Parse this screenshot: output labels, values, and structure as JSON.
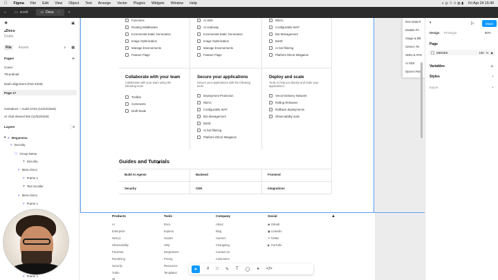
{
  "menubar": {
    "apple": "",
    "app": "Figma",
    "items": [
      "File",
      "Edit",
      "View",
      "Object",
      "Text",
      "Arrange",
      "Vector",
      "Plugins",
      "Widgets",
      "Window",
      "Help"
    ],
    "datetime": "Fri Apr 24 15:49"
  },
  "tabs": [
    {
      "label": "scroll"
    },
    {
      "label": "Docs"
    }
  ],
  "left": {
    "file_title": "Docs",
    "file_sub": "Drafts",
    "tab_file": "File",
    "tab_assets": "Assets",
    "pages_label": "Pages",
    "pages": [
      "Cover",
      "Thumbnail",
      "Dash alignment (Feb 2026)",
      "Page 17",
      "Geistdocs – Audit Chris (12/22/2025)",
      "AI chat shared link (11/02/2025)"
    ],
    "layers_label": "Layers",
    "layers": [
      "Megamenu",
      "Security",
      "Group Name",
      "Security",
      "Menu Docs",
      "Frame 1",
      "Text Scroller",
      "Menu Docs",
      "Frame 1",
      "Frame 1"
    ]
  },
  "canvas": {
    "col1_items": [
      "Functions",
      "Routing Middleware",
      "Incremental Static Generation",
      "Image Optimization",
      "Manage Environments",
      "Feature Flags"
    ],
    "col2_items": [
      "AI SDK",
      "AI Gateway",
      "Incremental Static Generation",
      "Image Optimization",
      "Manage Environments",
      "Feature Flags"
    ],
    "col3_items": [
      "RBAC",
      "Configurable WAF",
      "Bot Management",
      "BotID",
      "AI bot filtering",
      "Platform DDoS Mitigation"
    ],
    "cards": [
      {
        "title": "Collaborate with your team",
        "desc": "Collaborate with your team using the following tools:",
        "items": [
          "Toolbar",
          "Comments",
          "Draft Mode"
        ]
      },
      {
        "title": "Secure your applications",
        "desc": "Secure your applications with the following tools:",
        "items": [
          "Deployment Protection",
          "RBAC",
          "Configurable WAF",
          "Bot Management",
          "BotID",
          "AI bot filtering",
          "Platform DDoS Mitigation"
        ]
      },
      {
        "title": "Deploy and scale",
        "desc": "Tools to help you deploy and scale your applications:",
        "items": [
          "Vercel Delivery Network",
          "Rolling Releases",
          "Rollback deployments",
          "Observability suite"
        ]
      }
    ],
    "guides_title": "Guides and Tutorials",
    "guides": [
      "Build AI Agents",
      "Backend",
      "Frontend",
      "Security",
      "CDN",
      "Integrations"
    ],
    "footer": {
      "cols": [
        {
          "title": "Products",
          "items": [
            "AI",
            "Enterprise",
            "Next.js",
            "Observability",
            "Previews",
            "Rendering",
            "Security",
            "Turbo",
            "v0"
          ]
        },
        {
          "title": "Tools",
          "items": [
            "Docs",
            "Experts",
            "Guides",
            "Help",
            "Integrations",
            "Pricing",
            "Resources",
            "Templates"
          ]
        },
        {
          "title": "Company",
          "items": [
            "About",
            "Blog",
            "Careers",
            "Changelog",
            "Contact Us",
            "Customers",
            "Events"
          ]
        },
        {
          "title": "Social",
          "items": [
            "GitHub",
            "LinkedIn",
            "Twitter",
            "YouTube"
          ]
        }
      ]
    },
    "dropdown": [
      "Zero Data R",
      "Disable Pri",
      "Usage & Bill",
      "Service Ter",
      "SDKs & APIs",
      "AI SDK",
      "OpenAI Res"
    ]
  },
  "right": {
    "share": "Share",
    "tab_design": "Design",
    "tab_prototype": "Prototype",
    "zoom": "80%",
    "page_label": "Page",
    "page_color": "D9D9D9",
    "page_opacity": "100",
    "page_pct": "%",
    "variables": "Variables",
    "styles": "Styles",
    "export": "Export"
  }
}
